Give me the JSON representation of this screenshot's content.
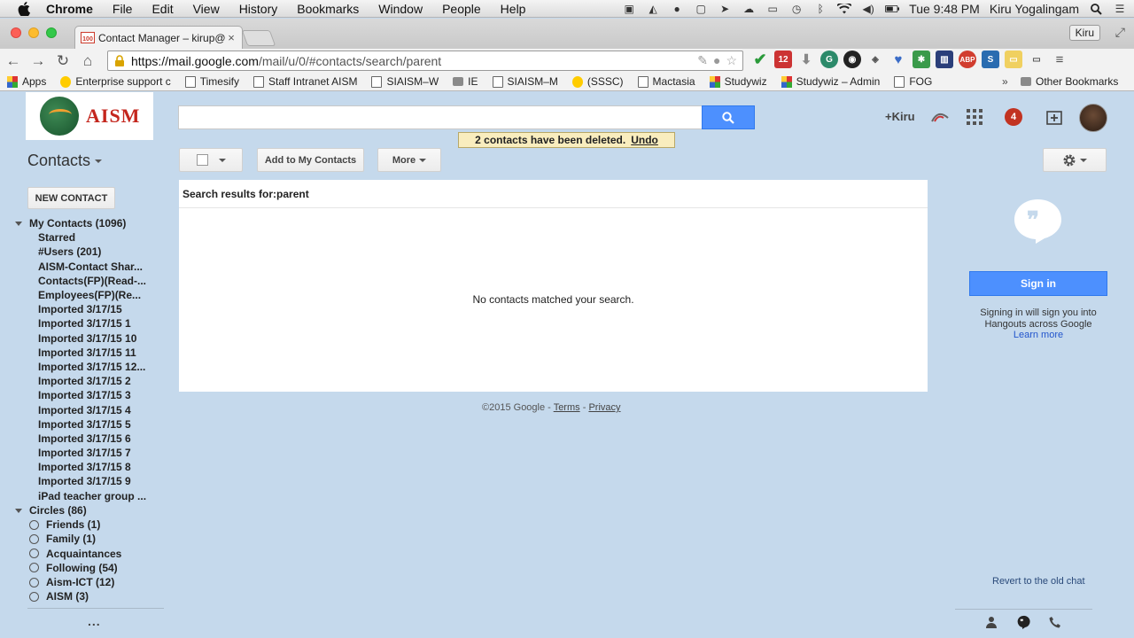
{
  "menubar": {
    "app": "Chrome",
    "items": [
      "File",
      "Edit",
      "View",
      "History",
      "Bookmarks",
      "Window",
      "People",
      "Help"
    ],
    "clock": "Tue 9:48 PM",
    "user": "Kiru Yogalingam"
  },
  "browser": {
    "tab_title": "Contact Manager – kirup@",
    "tab_favicon_badge": "100",
    "profile": "Kiru",
    "url_host": "https://mail.google.com",
    "url_path": "/mail/u/0/#contacts/search/parent",
    "extension_badge": "12",
    "extension_abp": "ABP",
    "extension_s": "S"
  },
  "bookmarks": {
    "items": [
      {
        "label": "Apps",
        "icon": "grid"
      },
      {
        "label": "Enterprise support c",
        "icon": "logo"
      },
      {
        "label": "Timesify",
        "icon": "page"
      },
      {
        "label": "Staff Intranet AISM",
        "icon": "page"
      },
      {
        "label": "SIAISM–W",
        "icon": "page"
      },
      {
        "label": "IE",
        "icon": "folder"
      },
      {
        "label": "SIAISM–M",
        "icon": "page"
      },
      {
        "label": "(SSSC)",
        "icon": "logo"
      },
      {
        "label": "Mactasia",
        "icon": "page"
      },
      {
        "label": "Studywiz",
        "icon": "grid"
      },
      {
        "label": "Studywiz – Admin",
        "icon": "grid"
      },
      {
        "label": "FOG",
        "icon": "page"
      }
    ],
    "more": "»",
    "other": "Other Bookmarks"
  },
  "app": {
    "logo_text": "AISM",
    "header_plus": "+Kiru",
    "notification_count": "4",
    "toast_message": "2 contacts have been deleted.",
    "toast_undo": "Undo",
    "contacts_title": "Contacts",
    "add_to_contacts": "Add to My Contacts",
    "more_button": "More",
    "new_contact": "NEW CONTACT",
    "search_results_label": "Search results for:parent",
    "no_results": "No contacts matched your search."
  },
  "sidebar": {
    "my_contacts": "My Contacts (1096)",
    "items": [
      "Starred",
      "#Users (201)",
      "AISM-Contact Shar...",
      "Contacts(FP)(Read-...",
      "Employees(FP)(Re...",
      "Imported 3/17/15",
      "Imported 3/17/15 1",
      "Imported 3/17/15 10",
      "Imported 3/17/15 11",
      "Imported 3/17/15 12...",
      "Imported 3/17/15 2",
      "Imported 3/17/15 3",
      "Imported 3/17/15 4",
      "Imported 3/17/15 5",
      "Imported 3/17/15 6",
      "Imported 3/17/15 7",
      "Imported 3/17/15 8",
      "Imported 3/17/15 9",
      "iPad teacher group ..."
    ],
    "circles": "Circles (86)",
    "circle_items": [
      "Friends (1)",
      "Family (1)",
      "Acquaintances",
      "Following (54)",
      "Aism-ICT (12)",
      "AISM (3)"
    ],
    "more_dots": "..."
  },
  "footer": {
    "copyright": "©2015 Google -",
    "terms": "Terms",
    "sep": "-",
    "privacy": "Privacy"
  },
  "hangouts": {
    "sign_in": "Sign in",
    "line1": "Signing in will sign you into",
    "line2": "Hangouts across Google",
    "learn_more": "Learn more",
    "revert": "Revert to the old chat"
  }
}
